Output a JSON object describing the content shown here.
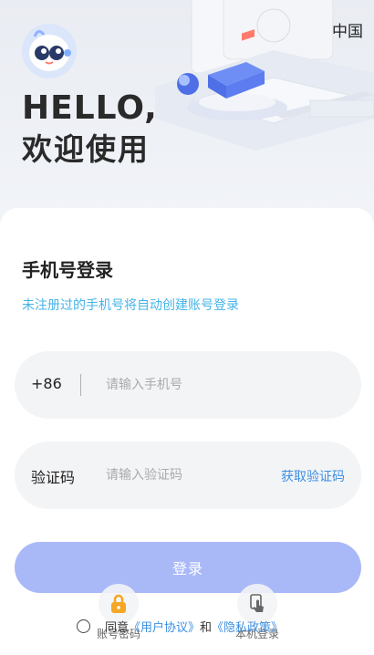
{
  "header": {
    "region": "中国",
    "greeting": "HELLO,",
    "welcome": "欢迎使用"
  },
  "login": {
    "title": "手机号登录",
    "hint": "未注册过的手机号将自动创建账号登录",
    "phone": {
      "prefix": "+86",
      "placeholder": "请输入手机号",
      "value": ""
    },
    "code": {
      "label": "验证码",
      "placeholder": "请输入验证码",
      "value": "",
      "get_code": "获取验证码"
    },
    "submit": "登录"
  },
  "agreement": {
    "checked": false,
    "prefix": "同意",
    "user_agreement": "《用户协议》",
    "and": "和",
    "privacy_policy": "《隐私政策》"
  },
  "quick_login": {
    "account": {
      "label": "账号密码",
      "icon": "lock-icon"
    },
    "local": {
      "label": "本机登录",
      "icon": "tap-icon"
    }
  },
  "colors": {
    "accent": "#3d8fe0",
    "hint": "#46b4e8",
    "button": "#a9b8f7",
    "lock": "#f5a623"
  }
}
